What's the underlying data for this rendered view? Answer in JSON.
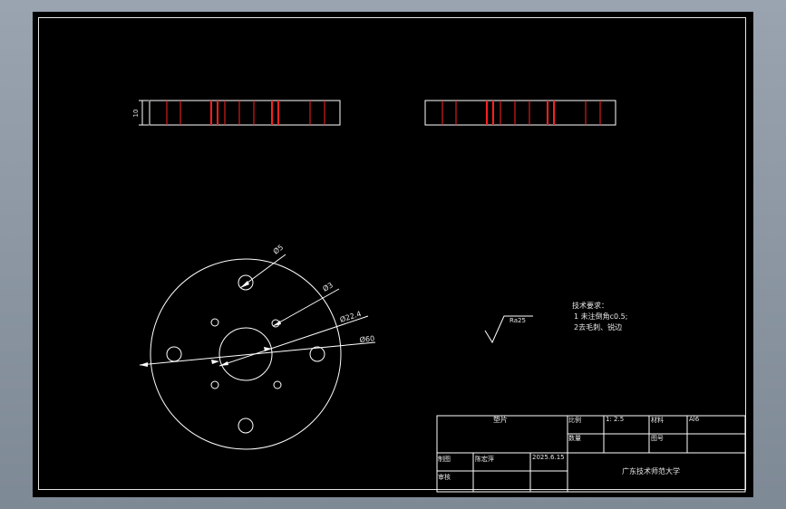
{
  "drawing": {
    "side_view": {
      "thickness_label": "10"
    },
    "holes": {
      "hole1": "Ø5",
      "hole2": "Ø3",
      "bore": "Ø22.4",
      "outer": "Ø60"
    },
    "roughness": "Ra25",
    "notes": {
      "title": "技术要求：",
      "line1": "1 未注倒角c0.5;",
      "line2": "2去毛刺、锐边"
    }
  },
  "title_block": {
    "part_name": "垫片",
    "scale_label": "比例",
    "scale_value": "1: 2.5",
    "material_label": "材料",
    "material_value": "Al6",
    "qty_label": "数量",
    "drawing_no_label": "图号",
    "drawer_label": "制图",
    "drawer_name": "陈宏萍",
    "date": "2025.6.15",
    "reviewer_label": "审核",
    "institution": "广东技术师范大学"
  },
  "colors": {
    "background": "#000000",
    "line": "#ffffff",
    "hidden": "#ff2020"
  }
}
